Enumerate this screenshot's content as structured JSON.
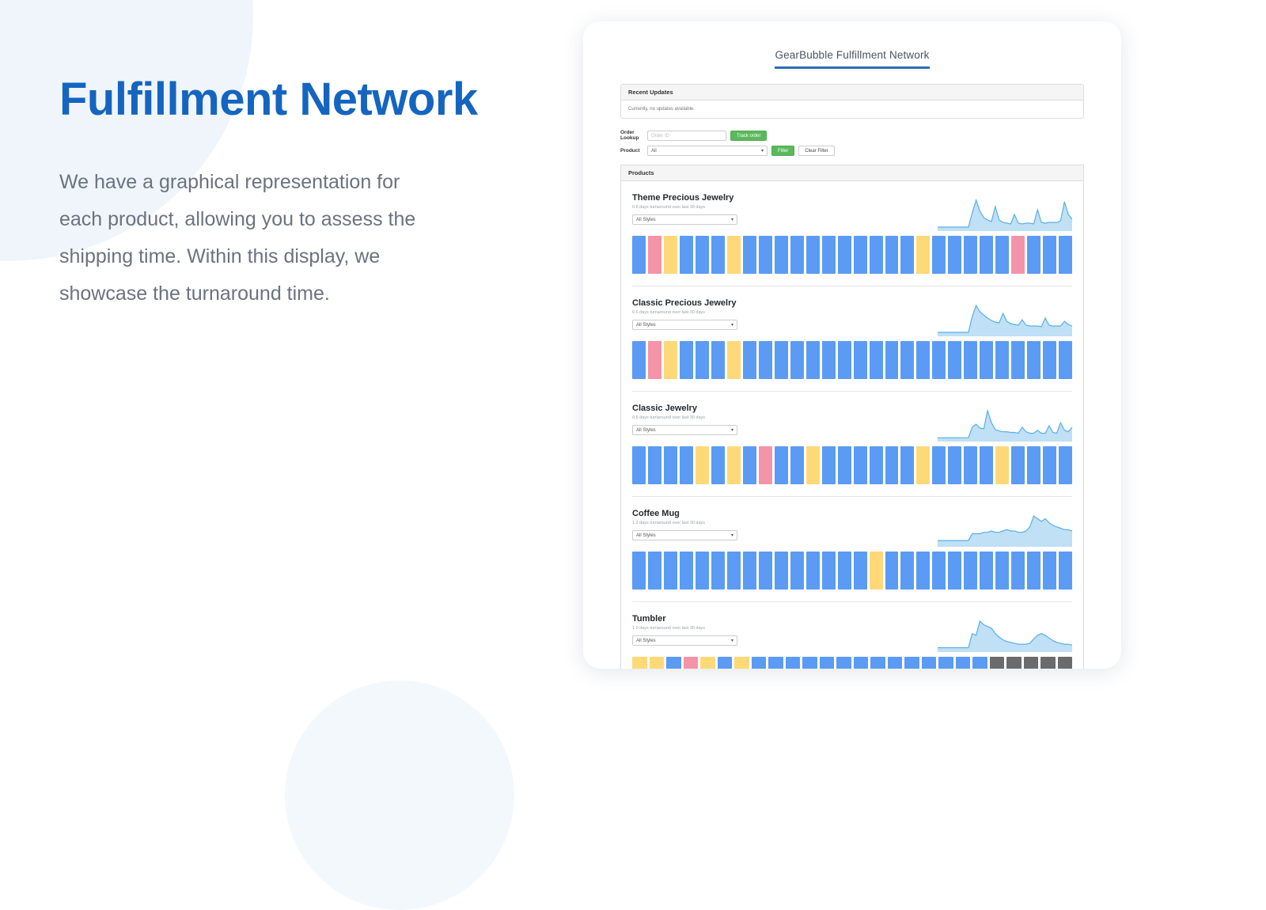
{
  "hero": {
    "headline": "Fulfillment Network",
    "body": "We have a graphical representation for each product, allowing you to assess the shipping time. Within this display, we showcase the turnaround time."
  },
  "colors": {
    "brand_blue": "#1565c0",
    "bar_blue": "#5b9bf3",
    "bar_yellow": "#ffd878",
    "bar_pink": "#f593a8",
    "bar_gray": "#6b6b6b",
    "spark_line": "#5aafe6",
    "spark_fill": "#bfe0f5",
    "green_button": "#5cb85c",
    "title_underline": "#2c6fb5"
  },
  "app": {
    "title": "GearBubble Fulfillment Network",
    "recent_updates": {
      "heading": "Recent Updates",
      "message": "Currently, no updates available."
    },
    "filters": {
      "order_lookup_label": "Order Lookup",
      "order_id_placeholder": "Order ID",
      "order_id_value": "",
      "track_order_label": "Track order",
      "product_label": "Product",
      "product_selected": "All",
      "filter_label": "Filter",
      "clear_filter_label": "Clear Filter"
    },
    "products_heading": "Products",
    "style_select_label": "All Styles",
    "products": [
      {
        "name": "Theme Precious Jewelry",
        "turnaround": "0.6 days turnaround over last 30 days",
        "style": "All Styles",
        "bars": [
          "blue",
          "pink",
          "yellow",
          "blue",
          "blue",
          "blue",
          "yellow",
          "blue",
          "blue",
          "blue",
          "blue",
          "blue",
          "blue",
          "blue",
          "blue",
          "blue",
          "blue",
          "blue",
          "yellow",
          "blue",
          "blue",
          "blue",
          "blue",
          "blue",
          "pink",
          "blue",
          "blue",
          "blue"
        ],
        "spark": [
          4,
          4,
          4,
          4,
          4,
          4,
          4,
          4,
          4,
          22,
          38,
          24,
          16,
          13,
          11,
          30,
          13,
          10,
          9,
          8,
          20,
          9,
          8,
          9,
          9,
          8,
          26,
          10,
          9,
          10,
          10,
          10,
          12,
          36,
          20,
          14
        ]
      },
      {
        "name": "Classic Precious Jewelry",
        "turnaround": "0.6 days turnaround over last 30 days",
        "style": "All Styles",
        "bars": [
          "blue",
          "pink",
          "yellow",
          "blue",
          "blue",
          "blue",
          "yellow",
          "blue",
          "blue",
          "blue",
          "blue",
          "blue",
          "blue",
          "blue",
          "blue",
          "blue",
          "blue",
          "blue",
          "blue",
          "blue",
          "blue",
          "blue",
          "blue",
          "blue",
          "blue",
          "blue",
          "blue",
          "blue"
        ],
        "spark": [
          4,
          4,
          4,
          4,
          4,
          4,
          4,
          4,
          4,
          24,
          38,
          30,
          26,
          22,
          19,
          17,
          16,
          28,
          18,
          15,
          14,
          13,
          20,
          13,
          12,
          12,
          12,
          11,
          22,
          13,
          12,
          12,
          12,
          18,
          14,
          12
        ]
      },
      {
        "name": "Classic Jewelry",
        "turnaround": "0.5 days turnaround over last 30 days",
        "style": "All Styles",
        "bars": [
          "blue",
          "blue",
          "blue",
          "blue",
          "yellow",
          "blue",
          "yellow",
          "blue",
          "pink",
          "blue",
          "blue",
          "yellow",
          "blue",
          "blue",
          "blue",
          "blue",
          "blue",
          "blue",
          "yellow",
          "blue",
          "blue",
          "blue",
          "blue",
          "yellow",
          "blue",
          "blue",
          "blue",
          "blue"
        ],
        "spark": [
          4,
          4,
          4,
          4,
          4,
          4,
          4,
          4,
          4,
          18,
          22,
          17,
          16,
          40,
          24,
          15,
          13,
          12,
          12,
          11,
          11,
          10,
          18,
          12,
          10,
          10,
          14,
          10,
          10,
          20,
          11,
          10,
          24,
          14,
          12,
          18
        ]
      },
      {
        "name": "Coffee Mug",
        "turnaround": "1.2 days turnaround over last 30 days",
        "style": "All Styles",
        "bars": [
          "blue",
          "blue",
          "blue",
          "blue",
          "blue",
          "blue",
          "blue",
          "blue",
          "blue",
          "blue",
          "blue",
          "blue",
          "blue",
          "blue",
          "blue",
          "yellow",
          "blue",
          "blue",
          "blue",
          "blue",
          "blue",
          "blue",
          "blue",
          "blue",
          "blue",
          "blue",
          "blue",
          "blue"
        ],
        "spark": [
          4,
          4,
          4,
          4,
          4,
          4,
          4,
          4,
          4,
          9,
          9,
          9,
          10,
          10,
          11,
          10,
          10,
          11,
          12,
          11,
          11,
          10,
          10,
          11,
          14,
          22,
          20,
          18,
          20,
          17,
          15,
          14,
          13,
          12,
          12,
          11
        ]
      },
      {
        "name": "Tumbler",
        "turnaround": "1.0 days turnaround over last 30 days",
        "style": "All Styles",
        "bars": [
          "yellow",
          "yellow",
          "blue",
          "pink",
          "yellow",
          "blue",
          "yellow",
          "blue",
          "blue",
          "blue",
          "blue",
          "blue",
          "blue",
          "blue",
          "blue",
          "blue",
          "blue",
          "blue",
          "blue",
          "blue",
          "blue",
          "gray",
          "gray",
          "gray",
          "gray",
          "gray"
        ],
        "spark": [
          4,
          4,
          4,
          4,
          4,
          4,
          4,
          4,
          4,
          20,
          18,
          34,
          30,
          28,
          26,
          20,
          16,
          13,
          11,
          10,
          9,
          8,
          8,
          8,
          9,
          14,
          18,
          20,
          18,
          15,
          12,
          10,
          9,
          8,
          8,
          7
        ]
      }
    ]
  }
}
